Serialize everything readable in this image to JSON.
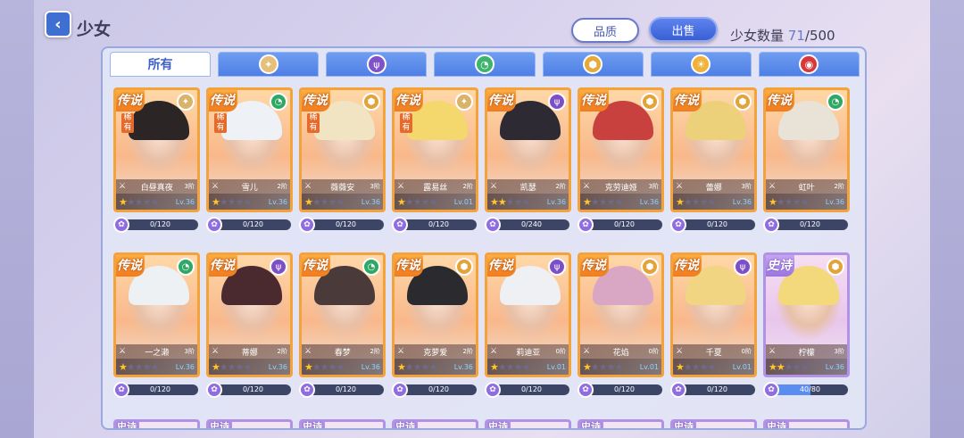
{
  "header": {
    "back_icon": "chevron-left-icon",
    "title": "少女",
    "quality_button": "品质",
    "sell_button": "出售",
    "count_label": "少女数量",
    "count_current": "71",
    "count_total": "/500"
  },
  "tabs": [
    {
      "label": "所有",
      "active": true
    },
    {
      "icon": "light-element-icon",
      "glyph": "✦",
      "color": "#e6c07a"
    },
    {
      "icon": "dark-element-icon",
      "glyph": "ψ",
      "color": "#7f52c9"
    },
    {
      "icon": "wind-element-icon",
      "glyph": "◔",
      "color": "#3db36b"
    },
    {
      "icon": "earth-element-icon",
      "glyph": "⬢",
      "color": "#e6a93a"
    },
    {
      "icon": "sun-element-icon",
      "glyph": "☀",
      "color": "#f0b23a"
    },
    {
      "icon": "fire-element-icon",
      "glyph": "◉",
      "color": "#d8383a"
    }
  ],
  "cards": [
    {
      "rank": "传说",
      "rare": "稀有",
      "name": "白昼真夜",
      "stage": "3阶",
      "stars": 1,
      "lv": "Lv.36",
      "frag": "0/120",
      "fill": 0,
      "elem": "light",
      "hair": "#2b2525"
    },
    {
      "rank": "传说",
      "rare": "稀有",
      "name": "雪儿",
      "stage": "2阶",
      "stars": 1,
      "lv": "Lv.36",
      "frag": "0/120",
      "fill": 0,
      "elem": "wind",
      "hair": "#eef2f7"
    },
    {
      "rank": "传说",
      "rare": "稀有",
      "name": "薇薇安",
      "stage": "3阶",
      "stars": 1,
      "lv": "Lv.36",
      "frag": "0/120",
      "fill": 0,
      "elem": "earth",
      "hair": "#f1e4c2"
    },
    {
      "rank": "传说",
      "rare": "稀有",
      "name": "露易丝",
      "stage": "2阶",
      "stars": 1,
      "lv": "Lv.01",
      "frag": "0/120",
      "fill": 0,
      "elem": "light",
      "hair": "#f5d86d"
    },
    {
      "rank": "传说",
      "rare": "",
      "name": "凯瑟",
      "stage": "2阶",
      "stars": 2,
      "lv": "Lv.36",
      "frag": "0/240",
      "fill": 0,
      "elem": "dark",
      "hair": "#2e2a34"
    },
    {
      "rank": "传说",
      "rare": "",
      "name": "克劳迪娅",
      "stage": "3阶",
      "stars": 1,
      "lv": "Lv.36",
      "frag": "0/120",
      "fill": 0,
      "elem": "earth",
      "hair": "#c8413e"
    },
    {
      "rank": "传说",
      "rare": "",
      "name": "蕾娜",
      "stage": "3阶",
      "stars": 1,
      "lv": "Lv.36",
      "frag": "0/120",
      "fill": 0,
      "elem": "earth",
      "hair": "#ecd07a"
    },
    {
      "rank": "传说",
      "rare": "",
      "name": "虹叶",
      "stage": "2阶",
      "stars": 1,
      "lv": "Lv.36",
      "frag": "0/120",
      "fill": 0,
      "elem": "wind",
      "hair": "#e9e2d6"
    },
    {
      "rank": "传说",
      "rare": "",
      "name": "一之濑",
      "stage": "3阶",
      "stars": 1,
      "lv": "Lv.36",
      "frag": "0/120",
      "fill": 0,
      "elem": "wind",
      "hair": "#eef1f4"
    },
    {
      "rank": "传说",
      "rare": "",
      "name": "蒂娜",
      "stage": "2阶",
      "stars": 1,
      "lv": "Lv.36",
      "frag": "0/120",
      "fill": 0,
      "elem": "dark",
      "hair": "#4a2a2f"
    },
    {
      "rank": "传说",
      "rare": "",
      "name": "春梦",
      "stage": "2阶",
      "stars": 1,
      "lv": "Lv.36",
      "frag": "0/120",
      "fill": 0,
      "elem": "wind",
      "hair": "#4b3a3a"
    },
    {
      "rank": "传说",
      "rare": "",
      "name": "克萝爱",
      "stage": "2阶",
      "stars": 1,
      "lv": "Lv.36",
      "frag": "0/120",
      "fill": 0,
      "elem": "earth",
      "hair": "#2b2b2f"
    },
    {
      "rank": "传说",
      "rare": "",
      "name": "莉迪亚",
      "stage": "0阶",
      "stars": 1,
      "lv": "Lv.01",
      "frag": "0/120",
      "fill": 0,
      "elem": "dark",
      "hair": "#eef0f4"
    },
    {
      "rank": "传说",
      "rare": "",
      "name": "花焰",
      "stage": "0阶",
      "stars": 1,
      "lv": "Lv.01",
      "frag": "0/120",
      "fill": 0,
      "elem": "earth",
      "hair": "#d9a6c4"
    },
    {
      "rank": "传说",
      "rare": "",
      "name": "千夏",
      "stage": "0阶",
      "stars": 1,
      "lv": "Lv.01",
      "frag": "0/120",
      "fill": 0,
      "elem": "dark",
      "hair": "#f1d582"
    },
    {
      "rank": "史诗",
      "rare": "",
      "name": "柠檬",
      "stage": "3阶",
      "stars": 2,
      "lv": "Lv.36",
      "frag": "40/80",
      "fill": 0.5,
      "elem": "earth",
      "hair": "#f4d87c",
      "epic": true
    }
  ],
  "peek_rank": "史诗",
  "element_colors": {
    "light": "#d9b36a",
    "wind": "#2fa866",
    "earth": "#e2a33a",
    "dark": "#7c4fc7"
  },
  "element_glyphs": {
    "light": "✦",
    "wind": "◔",
    "earth": "⬢",
    "dark": "ψ"
  }
}
